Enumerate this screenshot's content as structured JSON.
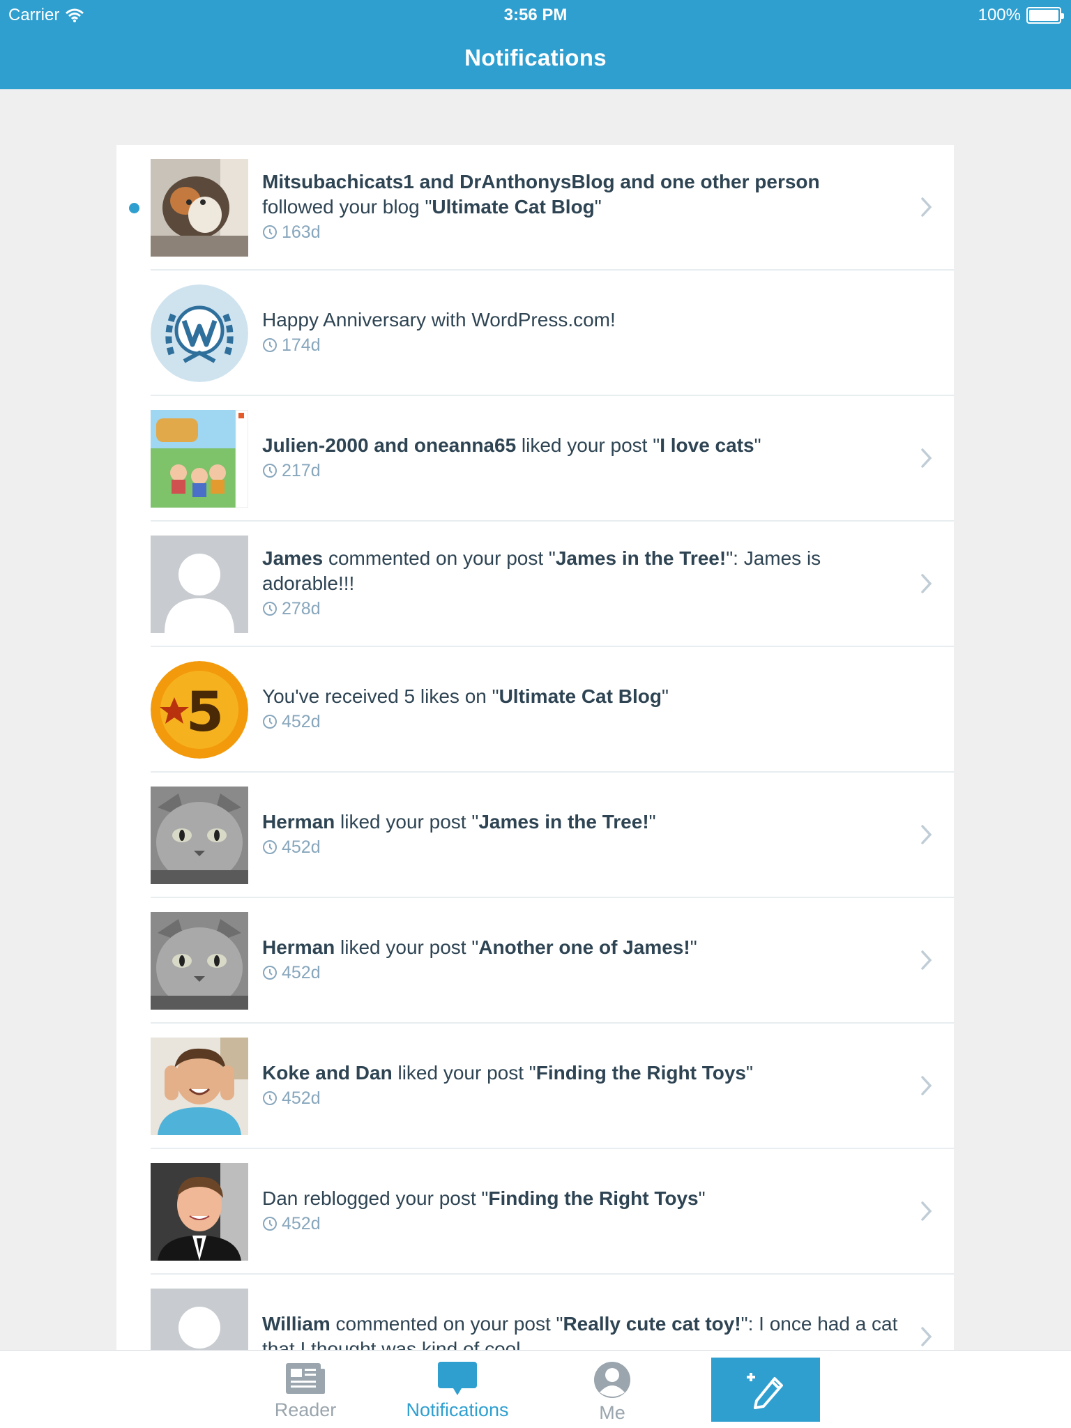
{
  "status_bar": {
    "carrier": "Carrier",
    "time": "3:56 PM",
    "battery": "100%"
  },
  "header": {
    "title": "Notifications"
  },
  "notifications": [
    {
      "avatar": "cat-photo-avatar",
      "parts": [
        {
          "t": "Mitsubachicats1 and DrAnthonysBlog and one other person",
          "b": true
        },
        {
          "t": "\nfollowed your blog \"",
          "b": false
        },
        {
          "t": "Ultimate Cat Blog",
          "b": true
        },
        {
          "t": "\"",
          "b": false
        }
      ],
      "time": "163d",
      "unread": true,
      "chevron": true
    },
    {
      "avatar": "wordpress-anniversary-badge",
      "parts": [
        {
          "t": "Happy Anniversary with WordPress.com!",
          "b": false
        }
      ],
      "time": "174d",
      "unread": false,
      "chevron": false
    },
    {
      "avatar": "animal-crossing-avatar",
      "parts": [
        {
          "t": "Julien-2000 and oneanna65",
          "b": true
        },
        {
          "t": " liked your post \"",
          "b": false
        },
        {
          "t": "I love cats",
          "b": true
        },
        {
          "t": "\"",
          "b": false
        }
      ],
      "time": "217d",
      "unread": false,
      "chevron": true
    },
    {
      "avatar": "default-user-avatar",
      "parts": [
        {
          "t": "James",
          "b": true
        },
        {
          "t": " commented on your post \"",
          "b": false
        },
        {
          "t": "James in the Tree!",
          "b": true
        },
        {
          "t": "\": James is adorable!!!",
          "b": false
        }
      ],
      "time": "278d",
      "unread": false,
      "chevron": true
    },
    {
      "avatar": "five-likes-badge",
      "parts": [
        {
          "t": "You've received 5 likes on \"",
          "b": false
        },
        {
          "t": "Ultimate Cat Blog",
          "b": true
        },
        {
          "t": "\"",
          "b": false
        }
      ],
      "time": "452d",
      "unread": false,
      "chevron": false
    },
    {
      "avatar": "gray-cat-avatar",
      "parts": [
        {
          "t": "Herman",
          "b": true
        },
        {
          "t": " liked your post \"",
          "b": false
        },
        {
          "t": "James in the Tree!",
          "b": true
        },
        {
          "t": "\"",
          "b": false
        }
      ],
      "time": "452d",
      "unread": false,
      "chevron": true
    },
    {
      "avatar": "gray-cat-avatar",
      "parts": [
        {
          "t": "Herman",
          "b": true
        },
        {
          "t": " liked your post \"",
          "b": false
        },
        {
          "t": "Another one of James!",
          "b": true
        },
        {
          "t": "\"",
          "b": false
        }
      ],
      "time": "452d",
      "unread": false,
      "chevron": true
    },
    {
      "avatar": "person-blue-shirt-avatar",
      "parts": [
        {
          "t": "Koke and Dan",
          "b": true
        },
        {
          "t": " liked your post \"",
          "b": false
        },
        {
          "t": "Finding the Right Toys",
          "b": true
        },
        {
          "t": "\"",
          "b": false
        }
      ],
      "time": "452d",
      "unread": false,
      "chevron": true
    },
    {
      "avatar": "person-suit-avatar",
      "parts": [
        {
          "t": "Dan reblogged your post \"",
          "b": false
        },
        {
          "t": "Finding the Right Toys",
          "b": true
        },
        {
          "t": "\"",
          "b": false
        }
      ],
      "time": "452d",
      "unread": false,
      "chevron": true
    },
    {
      "avatar": "default-user-avatar",
      "parts": [
        {
          "t": "William",
          "b": true
        },
        {
          "t": " commented on your post \"",
          "b": false
        },
        {
          "t": "Really cute cat toy!",
          "b": true
        },
        {
          "t": "\": I once had a cat that I thought was kind of cool.",
          "b": false
        }
      ],
      "time": "",
      "unread": false,
      "chevron": true
    }
  ],
  "tabbar": {
    "reader": "Reader",
    "notifications": "Notifications",
    "me": "Me",
    "compose_icon": "compose-pencil-icon"
  },
  "colors": {
    "brand": "#2f9fd0",
    "text": "#2e4453",
    "meta": "#87a6bc",
    "background": "#efefef"
  }
}
